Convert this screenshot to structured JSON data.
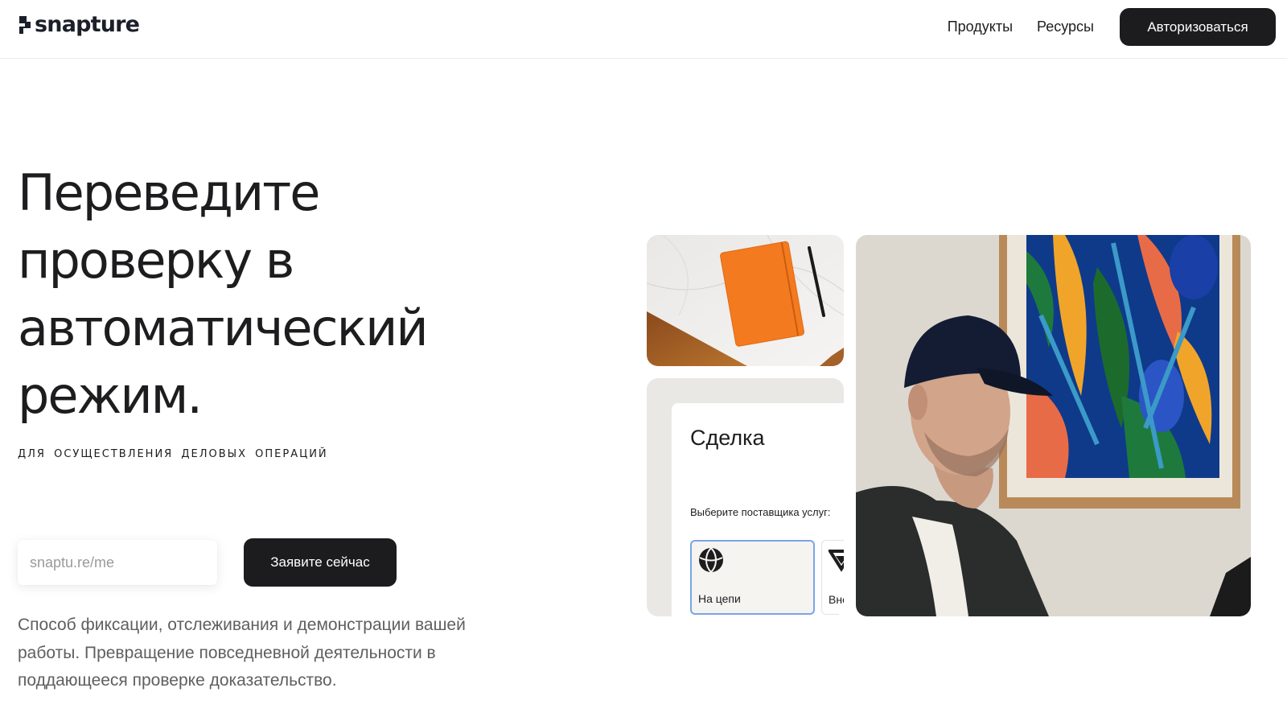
{
  "header": {
    "brand": "snapture",
    "nav": {
      "products": "Продукты",
      "resources": "Ресурсы",
      "login": "Авторизоваться"
    }
  },
  "hero": {
    "title_lines": [
      "Переведите",
      "проверку в",
      "автоматический",
      "режим."
    ],
    "subtitle": "для осуществления деловых операций",
    "claim_input_placeholder": "snaptu.re/me",
    "claim_button": "Заявите сейчас",
    "description": "Способ фиксации, отслеживания и демонстрации вашей работы. Превращение повседневной деятельности в поддающееся проверке доказательство."
  },
  "visual": {
    "deal_card": {
      "title": "Сделка",
      "provider_prompt": "Выберите поставщика услуг:",
      "providers": [
        {
          "label": "На цепи",
          "icon": "globe-icon",
          "selected": true
        },
        {
          "label": "Вне",
          "icon": "layers-logo-icon",
          "selected": false
        }
      ]
    },
    "notebook_image": "orange-notebook-with-pen-on-marble-desk",
    "portrait_image": "man-in-navy-cap-working-in-front-of-colorful-painting"
  },
  "colors": {
    "primary_button": "#1c1c1e",
    "selected_border": "#7aa5e6",
    "notebook_orange": "#f47a1f",
    "body_text": "#5f5f62"
  }
}
